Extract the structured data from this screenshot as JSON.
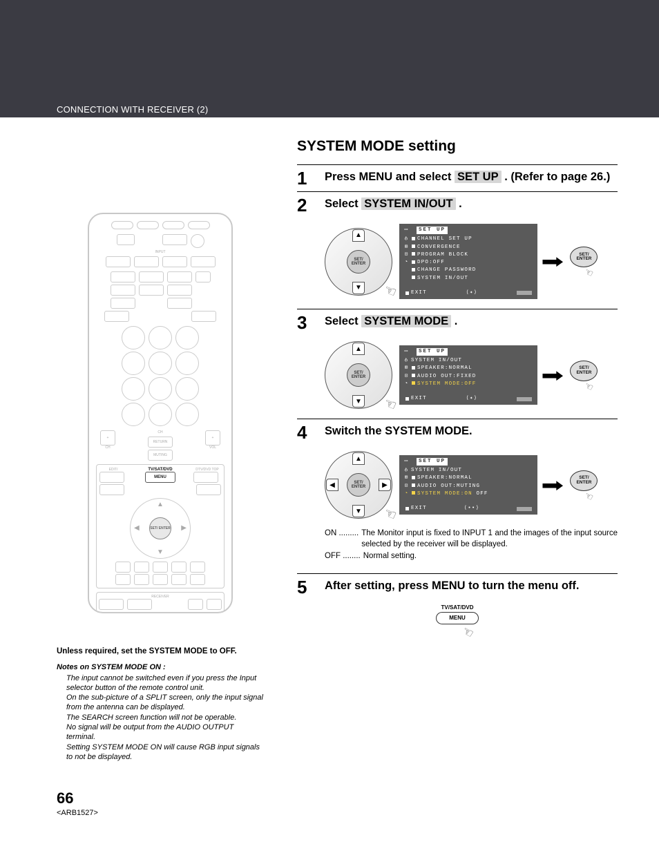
{
  "header": {
    "section_title": "CONNECTION WITH RECEIVER (2)"
  },
  "left": {
    "remote": {
      "tvsatdvd": "TV/SAT/DVD",
      "menu": "MENU",
      "dpad_center": "SET/\nENTER"
    },
    "note_head": "Unless required, set the SYSTEM MODE to OFF.",
    "note_sub": "Notes on SYSTEM MODE ON :",
    "note_body": "The input cannot be switched even if you press the Input selector button of the remote control unit.\nOn the sub-picture of a SPLIT screen, only the input signal from the antenna can be displayed.\nThe SEARCH screen function will not be operable.\nNo signal will be output from the AUDIO OUTPUT terminal.\nSetting SYSTEM MODE ON will cause RGB input signals to not be displayed."
  },
  "main": {
    "title": "SYSTEM MODE setting",
    "set_enter_label": "SET/\nENTER",
    "steps": [
      {
        "num": "1",
        "prefix": "Press MENU and select ",
        "highlight": "SET UP",
        "suffix": " . (Refer to page 26.)"
      },
      {
        "num": "2",
        "prefix": "Select ",
        "highlight": "SYSTEM IN/OUT",
        "suffix": " ."
      },
      {
        "num": "3",
        "prefix": "Select ",
        "highlight": "SYSTEM MODE",
        "suffix": " ."
      },
      {
        "num": "4",
        "text": "Switch the SYSTEM MODE."
      },
      {
        "num": "5",
        "text": "After setting, press MENU to turn the menu off."
      }
    ],
    "osd2": {
      "title": "SET UP",
      "lines": [
        "CHANNEL SET UP",
        "CONVERGENCE",
        "PROGRAM BLOCK",
        "DPO:OFF",
        "CHANGE PASSWORD",
        "SYSTEM IN/OUT"
      ],
      "exit": "EXIT"
    },
    "osd3": {
      "title": "SET UP",
      "lines": [
        "SYSTEM IN/OUT",
        "SPEAKER:NORMAL",
        "AUDIO OUT:FIXED"
      ],
      "hl_line": "SYSTEM MODE:OFF",
      "exit": "EXIT"
    },
    "osd4": {
      "title": "SET UP",
      "lines": [
        "SYSTEM IN/OUT",
        "SPEAKER:NORMAL",
        "AUDIO OUT:MUTING"
      ],
      "hl_prefix": "SYSTEM MODE:ON",
      "hl_suffix": " OFF",
      "exit": "EXIT"
    },
    "desc": {
      "on_key": "ON .........",
      "on_val": "The Monitor input is fixed to INPUT 1 and the images of the input source selected by the receiver will be displayed.",
      "off_key": "OFF ........",
      "off_val": "Normal setting."
    },
    "menu_mini": {
      "top": "TV/SAT/DVD",
      "btn": "MENU"
    }
  },
  "footer": {
    "page": "66",
    "code": "<ARB1527>"
  }
}
